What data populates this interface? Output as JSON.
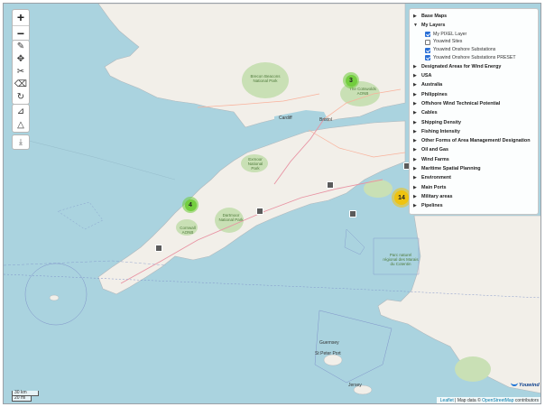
{
  "zoom": {
    "in_label": "+",
    "out_label": "−"
  },
  "draw_tools": [
    "polyline-icon",
    "move-icon",
    "cut-icon",
    "eraser-icon",
    "rotate-icon",
    "ruler-icon",
    "ruler-area-icon",
    "download-icon"
  ],
  "layers": {
    "groups": [
      {
        "label": "Base Maps",
        "expanded": false
      },
      {
        "label": "My Layers",
        "expanded": true,
        "children": [
          {
            "label": "My PIXEL Layer",
            "checked": true
          },
          {
            "label": "Youwind Sites",
            "checked": false
          },
          {
            "label": "Youwind Onshore Substations",
            "checked": true
          },
          {
            "label": "Youwind Onshore Substations PRESET",
            "checked": true
          }
        ]
      },
      {
        "label": "Designated Areas for Wind Energy",
        "expanded": false
      },
      {
        "label": "USA",
        "expanded": false
      },
      {
        "label": "Australia",
        "expanded": false
      },
      {
        "label": "Philippines",
        "expanded": false
      },
      {
        "label": "Offshore Wind Technical Potential",
        "expanded": false
      },
      {
        "label": "Cables",
        "expanded": false
      },
      {
        "label": "Shipping Density",
        "expanded": false
      },
      {
        "label": "Fishing Intensity",
        "expanded": false
      },
      {
        "label": "Other Forms of Area Management/ Designation",
        "expanded": false
      },
      {
        "label": "Oil and Gas",
        "expanded": false
      },
      {
        "label": "Wind Farms",
        "expanded": false
      },
      {
        "label": "Maritime Spatial Planning",
        "expanded": false
      },
      {
        "label": "Environment",
        "expanded": false
      },
      {
        "label": "Main Ports",
        "expanded": false
      },
      {
        "label": "Military areas",
        "expanded": false
      },
      {
        "label": "Pipelines",
        "expanded": false
      }
    ]
  },
  "clusters": [
    {
      "count": "3",
      "color": "green"
    },
    {
      "count": "4",
      "color": "green"
    },
    {
      "count": "14",
      "color": "yellow"
    }
  ],
  "places": {
    "cardiff": "Cardiff",
    "bristol": "Bristol",
    "guernsey": "Guernsey",
    "st_peter_port": "St Peter Port",
    "jersey": "Jersey"
  },
  "parks": {
    "exmoor": "Exmoor National Park",
    "dartmoor": "Dartmoor National Park",
    "brecon": "Brecon Beacons National Park",
    "cornwall": "Cornwall AONB",
    "cotswolds": "The Cotswolds AONB",
    "dorset": "North Devon AONB",
    "cotentin": "Parc naturel régional des Marais du Cotentin"
  },
  "scale": {
    "km": "30 km",
    "mi": "20 mi"
  },
  "logo": {
    "text": "Youwind"
  },
  "attribution": {
    "leaflet": "Leaflet",
    "sep": " | Map data © ",
    "osm": "OpenStreetMap",
    "tail": " contributors"
  },
  "colors": {
    "sea": "#aad3df",
    "land": "#f2efe9",
    "park": "#c9e0b5",
    "accent": "#2a6fd6"
  }
}
